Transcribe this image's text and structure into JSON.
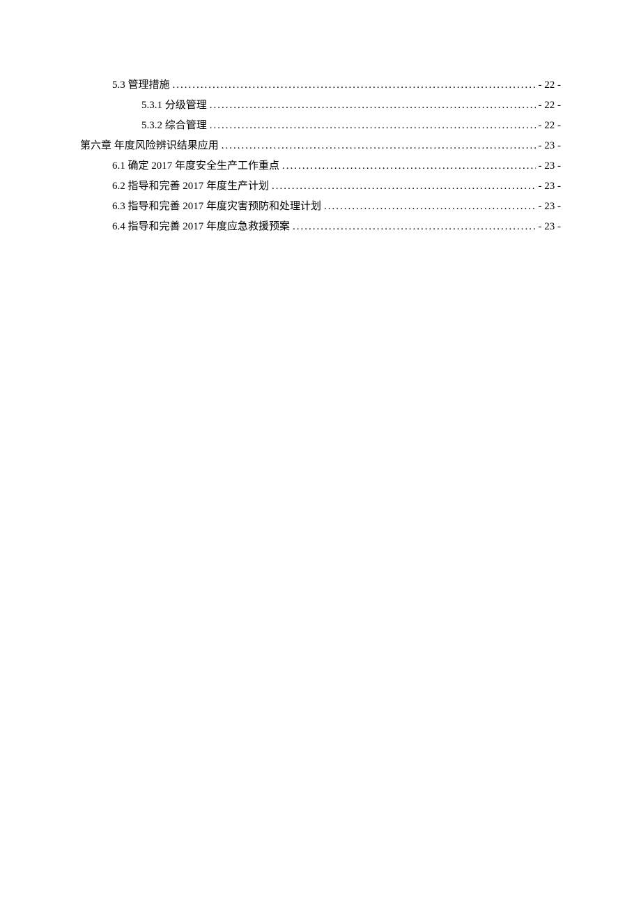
{
  "toc": [
    {
      "indent": 1,
      "label": "5.3  管理措施",
      "page": "- 22 -"
    },
    {
      "indent": 2,
      "label": "5.3.1  分级管理",
      "page": "- 22 -"
    },
    {
      "indent": 2,
      "label": "5.3.2  综合管理",
      "page": "- 22 -"
    },
    {
      "indent": 0,
      "label": "第六章  年度风险辨识结果应用",
      "page": "- 23 -"
    },
    {
      "indent": 1,
      "label": "6.1  确定 2017 年度安全生产工作重点",
      "page": "- 23 -"
    },
    {
      "indent": 1,
      "label": "6.2  指导和完善 2017 年度生产计划",
      "page": "- 23 -"
    },
    {
      "indent": 1,
      "label": "6.3  指导和完善 2017 年度灾害预防和处理计划",
      "page": "- 23 -"
    },
    {
      "indent": 1,
      "label": "6.4  指导和完善 2017 年度应急救援预案",
      "page": "- 23 -"
    }
  ]
}
